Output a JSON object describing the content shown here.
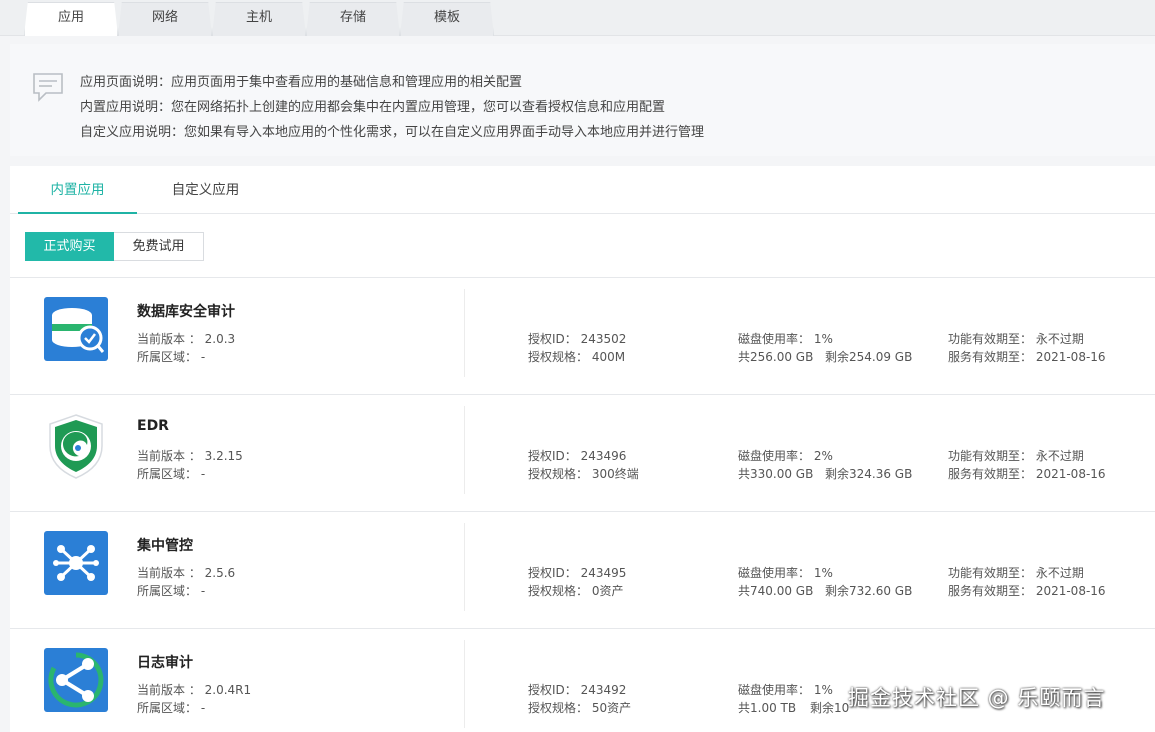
{
  "top_tabs": [
    "应用",
    "网络",
    "主机",
    "存储",
    "模板"
  ],
  "info": {
    "lines": [
      "应用页面说明：应用页面用于集中查看应用的基础信息和管理应用的相关配置",
      "内置应用说明：您在网络拓扑上创建的应用都会集中在内置应用管理，您可以查看授权信息和应用配置",
      "自定义应用说明：您如果有导入本地应用的个性化需求，可以在自定义应用界面手动导入本地应用并进行管理"
    ]
  },
  "sub_tabs": [
    "内置应用",
    "自定义应用"
  ],
  "filter": {
    "on": "正式购买",
    "off": "免费试用"
  },
  "apps": [
    {
      "name": "数据库安全审计",
      "version": "当前版本 ：  2.0.3",
      "region": "所属区域：  -",
      "auth_id": "授权ID：  243502",
      "auth_spec": "授权规格：  400M",
      "disk_rate": "磁盘使用率：  1%",
      "disk_total": "共256.00 GB",
      "disk_left": "剩余254.09 GB",
      "func_valid": "功能有效期至：  永不过期",
      "service_valid": "服务有效期至：  2021-08-16",
      "icon": "database-audit-icon"
    },
    {
      "name": "EDR",
      "version": "当前版本 ：  3.2.15",
      "region": "所属区域：  -",
      "auth_id": "授权ID：  243496",
      "auth_spec": "授权规格：  300终端",
      "disk_rate": "磁盘使用率：  2%",
      "disk_total": "共330.00 GB",
      "disk_left": "剩余324.36 GB",
      "func_valid": "功能有效期至：  永不过期",
      "service_valid": "服务有效期至：  2021-08-16",
      "icon": "edr-shield-icon"
    },
    {
      "name": "集中管控",
      "version": "当前版本 ：  2.5.6",
      "region": "所属区域：  -",
      "auth_id": "授权ID：  243495",
      "auth_spec": "授权规格：  0资产",
      "disk_rate": "磁盘使用率：  1%",
      "disk_total": "共740.00 GB",
      "disk_left": "剩余732.60 GB",
      "func_valid": "功能有效期至：  永不过期",
      "service_valid": "服务有效期至：  2021-08-16",
      "icon": "central-control-icon"
    },
    {
      "name": "日志审计",
      "version": "当前版本 ：  2.0.4R1",
      "region": "所属区域：  -",
      "auth_id": "授权ID：  243492",
      "auth_spec": "授权规格：  50资产",
      "disk_rate": "磁盘使用率：  1%",
      "disk_total": "共1.00 TB",
      "disk_left": "剩余10",
      "func_valid": "",
      "service_valid": "",
      "icon": "log-audit-icon"
    }
  ],
  "watermark": "掘金技术社区 @ 乐颐而言",
  "colors": {
    "accent": "#22b9a9",
    "icon_blue": "#2b7fd6"
  }
}
